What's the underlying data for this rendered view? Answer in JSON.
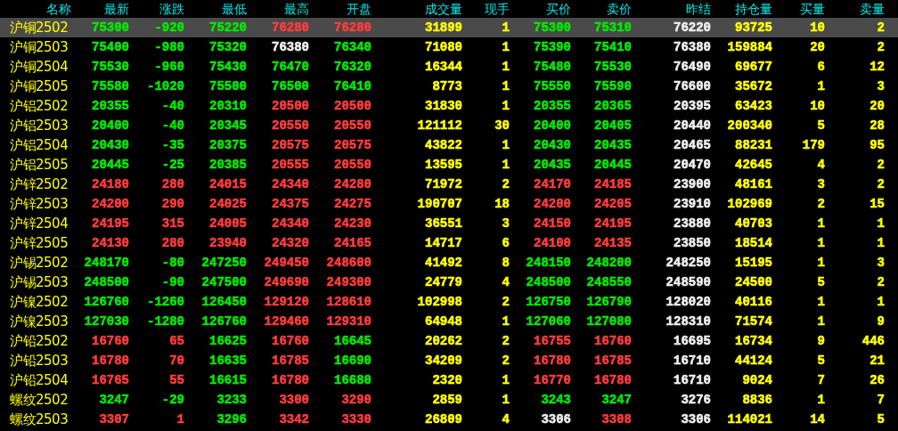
{
  "columns": [
    "名称",
    "最新",
    "涨跌",
    "最低",
    "最高",
    "开盘",
    "成交量",
    "现手",
    "买价",
    "卖价",
    "昨结",
    "持仓量",
    "买量",
    "卖量"
  ],
  "rows": [
    {
      "name": "沪铜2502",
      "selected": true,
      "cells": [
        {
          "text": "75300",
          "color": "#00ea00"
        },
        {
          "text": "-920",
          "color": "#00ea00"
        },
        {
          "text": "75220",
          "color": "#00ea00"
        },
        {
          "text": "76280",
          "color": "#ff3c3c"
        },
        {
          "text": "76280",
          "color": "#ff3c3c"
        },
        {
          "text": "31899",
          "color": "#ffff00"
        },
        {
          "text": "1",
          "color": "#ffff00"
        },
        {
          "text": "75300",
          "color": "#00ea00"
        },
        {
          "text": "75310",
          "color": "#00ea00"
        },
        {
          "text": "76220",
          "color": "#eeeeee"
        },
        {
          "text": "93725",
          "color": "#ffff00"
        },
        {
          "text": "10",
          "color": "#ffff00"
        },
        {
          "text": "2",
          "color": "#ffff00"
        }
      ]
    },
    {
      "name": "沪铜2503",
      "selected": false,
      "cells": [
        {
          "text": "75400",
          "color": "#00ea00"
        },
        {
          "text": "-980",
          "color": "#00ea00"
        },
        {
          "text": "75320",
          "color": "#00ea00"
        },
        {
          "text": "76380",
          "color": "#eeeeee"
        },
        {
          "text": "76340",
          "color": "#00ea00"
        },
        {
          "text": "71080",
          "color": "#ffff00"
        },
        {
          "text": "1",
          "color": "#ffff00"
        },
        {
          "text": "75390",
          "color": "#00ea00"
        },
        {
          "text": "75410",
          "color": "#00ea00"
        },
        {
          "text": "76380",
          "color": "#eeeeee"
        },
        {
          "text": "159884",
          "color": "#ffff00"
        },
        {
          "text": "20",
          "color": "#ffff00"
        },
        {
          "text": "2",
          "color": "#ffff00"
        }
      ]
    },
    {
      "name": "沪铜2504",
      "selected": false,
      "cells": [
        {
          "text": "75530",
          "color": "#00ea00"
        },
        {
          "text": "-960",
          "color": "#00ea00"
        },
        {
          "text": "75430",
          "color": "#00ea00"
        },
        {
          "text": "76470",
          "color": "#00ea00"
        },
        {
          "text": "76320",
          "color": "#00ea00"
        },
        {
          "text": "16344",
          "color": "#ffff00"
        },
        {
          "text": "1",
          "color": "#ffff00"
        },
        {
          "text": "75480",
          "color": "#00ea00"
        },
        {
          "text": "75530",
          "color": "#00ea00"
        },
        {
          "text": "76490",
          "color": "#eeeeee"
        },
        {
          "text": "69677",
          "color": "#ffff00"
        },
        {
          "text": "6",
          "color": "#ffff00"
        },
        {
          "text": "12",
          "color": "#ffff00"
        }
      ]
    },
    {
      "name": "沪铜2505",
      "selected": false,
      "cells": [
        {
          "text": "75580",
          "color": "#00ea00"
        },
        {
          "text": "-1020",
          "color": "#00ea00"
        },
        {
          "text": "75500",
          "color": "#00ea00"
        },
        {
          "text": "76500",
          "color": "#00ea00"
        },
        {
          "text": "76410",
          "color": "#00ea00"
        },
        {
          "text": "8773",
          "color": "#ffff00"
        },
        {
          "text": "1",
          "color": "#ffff00"
        },
        {
          "text": "75550",
          "color": "#00ea00"
        },
        {
          "text": "75590",
          "color": "#00ea00"
        },
        {
          "text": "76600",
          "color": "#eeeeee"
        },
        {
          "text": "35672",
          "color": "#ffff00"
        },
        {
          "text": "1",
          "color": "#ffff00"
        },
        {
          "text": "3",
          "color": "#ffff00"
        }
      ]
    },
    {
      "name": "沪铝2502",
      "selected": false,
      "cells": [
        {
          "text": "20355",
          "color": "#00ea00"
        },
        {
          "text": "-40",
          "color": "#00ea00"
        },
        {
          "text": "20310",
          "color": "#00ea00"
        },
        {
          "text": "20500",
          "color": "#ff3c3c"
        },
        {
          "text": "20500",
          "color": "#ff3c3c"
        },
        {
          "text": "31830",
          "color": "#ffff00"
        },
        {
          "text": "1",
          "color": "#ffff00"
        },
        {
          "text": "20355",
          "color": "#00ea00"
        },
        {
          "text": "20365",
          "color": "#00ea00"
        },
        {
          "text": "20395",
          "color": "#eeeeee"
        },
        {
          "text": "63423",
          "color": "#ffff00"
        },
        {
          "text": "10",
          "color": "#ffff00"
        },
        {
          "text": "20",
          "color": "#ffff00"
        }
      ]
    },
    {
      "name": "沪铝2503",
      "selected": false,
      "cells": [
        {
          "text": "20400",
          "color": "#00ea00"
        },
        {
          "text": "-40",
          "color": "#00ea00"
        },
        {
          "text": "20345",
          "color": "#00ea00"
        },
        {
          "text": "20550",
          "color": "#ff3c3c"
        },
        {
          "text": "20550",
          "color": "#ff3c3c"
        },
        {
          "text": "121112",
          "color": "#ffff00"
        },
        {
          "text": "30",
          "color": "#ffff00"
        },
        {
          "text": "20400",
          "color": "#00ea00"
        },
        {
          "text": "20405",
          "color": "#00ea00"
        },
        {
          "text": "20440",
          "color": "#eeeeee"
        },
        {
          "text": "200340",
          "color": "#ffff00"
        },
        {
          "text": "5",
          "color": "#ffff00"
        },
        {
          "text": "28",
          "color": "#ffff00"
        }
      ]
    },
    {
      "name": "沪铝2504",
      "selected": false,
      "cells": [
        {
          "text": "20430",
          "color": "#00ea00"
        },
        {
          "text": "-35",
          "color": "#00ea00"
        },
        {
          "text": "20375",
          "color": "#00ea00"
        },
        {
          "text": "20575",
          "color": "#ff3c3c"
        },
        {
          "text": "20575",
          "color": "#ff3c3c"
        },
        {
          "text": "43822",
          "color": "#ffff00"
        },
        {
          "text": "1",
          "color": "#ffff00"
        },
        {
          "text": "20430",
          "color": "#00ea00"
        },
        {
          "text": "20435",
          "color": "#00ea00"
        },
        {
          "text": "20465",
          "color": "#eeeeee"
        },
        {
          "text": "88231",
          "color": "#ffff00"
        },
        {
          "text": "179",
          "color": "#ffff00"
        },
        {
          "text": "95",
          "color": "#ffff00"
        }
      ]
    },
    {
      "name": "沪铝2505",
      "selected": false,
      "cells": [
        {
          "text": "20445",
          "color": "#00ea00"
        },
        {
          "text": "-25",
          "color": "#00ea00"
        },
        {
          "text": "20385",
          "color": "#00ea00"
        },
        {
          "text": "20555",
          "color": "#ff3c3c"
        },
        {
          "text": "20550",
          "color": "#ff3c3c"
        },
        {
          "text": "13595",
          "color": "#ffff00"
        },
        {
          "text": "1",
          "color": "#ffff00"
        },
        {
          "text": "20435",
          "color": "#00ea00"
        },
        {
          "text": "20445",
          "color": "#00ea00"
        },
        {
          "text": "20470",
          "color": "#eeeeee"
        },
        {
          "text": "42645",
          "color": "#ffff00"
        },
        {
          "text": "4",
          "color": "#ffff00"
        },
        {
          "text": "2",
          "color": "#ffff00"
        }
      ]
    },
    {
      "name": "沪锌2502",
      "selected": false,
      "cells": [
        {
          "text": "24180",
          "color": "#ff3c3c"
        },
        {
          "text": "280",
          "color": "#ff3c3c"
        },
        {
          "text": "24015",
          "color": "#ff3c3c"
        },
        {
          "text": "24340",
          "color": "#ff3c3c"
        },
        {
          "text": "24280",
          "color": "#ff3c3c"
        },
        {
          "text": "71972",
          "color": "#ffff00"
        },
        {
          "text": "2",
          "color": "#ffff00"
        },
        {
          "text": "24170",
          "color": "#ff3c3c"
        },
        {
          "text": "24185",
          "color": "#ff3c3c"
        },
        {
          "text": "23900",
          "color": "#eeeeee"
        },
        {
          "text": "48161",
          "color": "#ffff00"
        },
        {
          "text": "3",
          "color": "#ffff00"
        },
        {
          "text": "2",
          "color": "#ffff00"
        }
      ]
    },
    {
      "name": "沪锌2503",
      "selected": false,
      "cells": [
        {
          "text": "24200",
          "color": "#ff3c3c"
        },
        {
          "text": "290",
          "color": "#ff3c3c"
        },
        {
          "text": "24025",
          "color": "#ff3c3c"
        },
        {
          "text": "24375",
          "color": "#ff3c3c"
        },
        {
          "text": "24275",
          "color": "#ff3c3c"
        },
        {
          "text": "190707",
          "color": "#ffff00"
        },
        {
          "text": "18",
          "color": "#ffff00"
        },
        {
          "text": "24200",
          "color": "#ff3c3c"
        },
        {
          "text": "24205",
          "color": "#ff3c3c"
        },
        {
          "text": "23910",
          "color": "#eeeeee"
        },
        {
          "text": "102969",
          "color": "#ffff00"
        },
        {
          "text": "2",
          "color": "#ffff00"
        },
        {
          "text": "15",
          "color": "#ffff00"
        }
      ]
    },
    {
      "name": "沪锌2504",
      "selected": false,
      "cells": [
        {
          "text": "24195",
          "color": "#ff3c3c"
        },
        {
          "text": "315",
          "color": "#ff3c3c"
        },
        {
          "text": "24005",
          "color": "#ff3c3c"
        },
        {
          "text": "24340",
          "color": "#ff3c3c"
        },
        {
          "text": "24230",
          "color": "#ff3c3c"
        },
        {
          "text": "36551",
          "color": "#ffff00"
        },
        {
          "text": "3",
          "color": "#ffff00"
        },
        {
          "text": "24150",
          "color": "#ff3c3c"
        },
        {
          "text": "24195",
          "color": "#ff3c3c"
        },
        {
          "text": "23880",
          "color": "#eeeeee"
        },
        {
          "text": "40703",
          "color": "#ffff00"
        },
        {
          "text": "1",
          "color": "#ffff00"
        },
        {
          "text": "1",
          "color": "#ffff00"
        }
      ]
    },
    {
      "name": "沪锌2505",
      "selected": false,
      "cells": [
        {
          "text": "24130",
          "color": "#ff3c3c"
        },
        {
          "text": "280",
          "color": "#ff3c3c"
        },
        {
          "text": "23940",
          "color": "#ff3c3c"
        },
        {
          "text": "24320",
          "color": "#ff3c3c"
        },
        {
          "text": "24165",
          "color": "#ff3c3c"
        },
        {
          "text": "14717",
          "color": "#ffff00"
        },
        {
          "text": "6",
          "color": "#ffff00"
        },
        {
          "text": "24100",
          "color": "#ff3c3c"
        },
        {
          "text": "24135",
          "color": "#ff3c3c"
        },
        {
          "text": "23850",
          "color": "#eeeeee"
        },
        {
          "text": "18514",
          "color": "#ffff00"
        },
        {
          "text": "1",
          "color": "#ffff00"
        },
        {
          "text": "1",
          "color": "#ffff00"
        }
      ]
    },
    {
      "name": "沪锡2502",
      "selected": false,
      "cells": [
        {
          "text": "248170",
          "color": "#00ea00"
        },
        {
          "text": "-80",
          "color": "#00ea00"
        },
        {
          "text": "247250",
          "color": "#00ea00"
        },
        {
          "text": "249450",
          "color": "#ff3c3c"
        },
        {
          "text": "248600",
          "color": "#ff3c3c"
        },
        {
          "text": "41492",
          "color": "#ffff00"
        },
        {
          "text": "8",
          "color": "#ffff00"
        },
        {
          "text": "248150",
          "color": "#00ea00"
        },
        {
          "text": "248200",
          "color": "#00ea00"
        },
        {
          "text": "248250",
          "color": "#eeeeee"
        },
        {
          "text": "15195",
          "color": "#ffff00"
        },
        {
          "text": "1",
          "color": "#ffff00"
        },
        {
          "text": "3",
          "color": "#ffff00"
        }
      ]
    },
    {
      "name": "沪锡2503",
      "selected": false,
      "cells": [
        {
          "text": "248500",
          "color": "#00ea00"
        },
        {
          "text": "-90",
          "color": "#00ea00"
        },
        {
          "text": "247500",
          "color": "#00ea00"
        },
        {
          "text": "249690",
          "color": "#ff3c3c"
        },
        {
          "text": "249300",
          "color": "#ff3c3c"
        },
        {
          "text": "24779",
          "color": "#ffff00"
        },
        {
          "text": "4",
          "color": "#ffff00"
        },
        {
          "text": "248500",
          "color": "#00ea00"
        },
        {
          "text": "248550",
          "color": "#00ea00"
        },
        {
          "text": "248590",
          "color": "#eeeeee"
        },
        {
          "text": "24500",
          "color": "#ffff00"
        },
        {
          "text": "5",
          "color": "#ffff00"
        },
        {
          "text": "2",
          "color": "#ffff00"
        }
      ]
    },
    {
      "name": "沪镍2502",
      "selected": false,
      "cells": [
        {
          "text": "126760",
          "color": "#00ea00"
        },
        {
          "text": "-1260",
          "color": "#00ea00"
        },
        {
          "text": "126450",
          "color": "#00ea00"
        },
        {
          "text": "129120",
          "color": "#ff3c3c"
        },
        {
          "text": "128610",
          "color": "#ff3c3c"
        },
        {
          "text": "102998",
          "color": "#ffff00"
        },
        {
          "text": "2",
          "color": "#ffff00"
        },
        {
          "text": "126750",
          "color": "#00ea00"
        },
        {
          "text": "126790",
          "color": "#00ea00"
        },
        {
          "text": "128020",
          "color": "#eeeeee"
        },
        {
          "text": "40116",
          "color": "#ffff00"
        },
        {
          "text": "1",
          "color": "#ffff00"
        },
        {
          "text": "1",
          "color": "#ffff00"
        }
      ]
    },
    {
      "name": "沪镍2503",
      "selected": false,
      "cells": [
        {
          "text": "127030",
          "color": "#00ea00"
        },
        {
          "text": "-1280",
          "color": "#00ea00"
        },
        {
          "text": "126760",
          "color": "#00ea00"
        },
        {
          "text": "129460",
          "color": "#ff3c3c"
        },
        {
          "text": "129310",
          "color": "#ff3c3c"
        },
        {
          "text": "64948",
          "color": "#ffff00"
        },
        {
          "text": "1",
          "color": "#ffff00"
        },
        {
          "text": "127060",
          "color": "#00ea00"
        },
        {
          "text": "127080",
          "color": "#00ea00"
        },
        {
          "text": "128310",
          "color": "#eeeeee"
        },
        {
          "text": "71574",
          "color": "#ffff00"
        },
        {
          "text": "1",
          "color": "#ffff00"
        },
        {
          "text": "9",
          "color": "#ffff00"
        }
      ]
    },
    {
      "name": "沪铅2502",
      "selected": false,
      "cells": [
        {
          "text": "16760",
          "color": "#ff3c3c"
        },
        {
          "text": "65",
          "color": "#ff3c3c"
        },
        {
          "text": "16625",
          "color": "#00ea00"
        },
        {
          "text": "16760",
          "color": "#ff3c3c"
        },
        {
          "text": "16645",
          "color": "#00ea00"
        },
        {
          "text": "20262",
          "color": "#ffff00"
        },
        {
          "text": "2",
          "color": "#ffff00"
        },
        {
          "text": "16755",
          "color": "#ff3c3c"
        },
        {
          "text": "16760",
          "color": "#ff3c3c"
        },
        {
          "text": "16695",
          "color": "#eeeeee"
        },
        {
          "text": "16734",
          "color": "#ffff00"
        },
        {
          "text": "9",
          "color": "#ffff00"
        },
        {
          "text": "446",
          "color": "#ffff00"
        }
      ]
    },
    {
      "name": "沪铅2503",
      "selected": false,
      "cells": [
        {
          "text": "16780",
          "color": "#ff3c3c"
        },
        {
          "text": "70",
          "color": "#ff3c3c"
        },
        {
          "text": "16635",
          "color": "#00ea00"
        },
        {
          "text": "16785",
          "color": "#ff3c3c"
        },
        {
          "text": "16690",
          "color": "#00ea00"
        },
        {
          "text": "34209",
          "color": "#ffff00"
        },
        {
          "text": "2",
          "color": "#ffff00"
        },
        {
          "text": "16780",
          "color": "#ff3c3c"
        },
        {
          "text": "16785",
          "color": "#ff3c3c"
        },
        {
          "text": "16710",
          "color": "#eeeeee"
        },
        {
          "text": "44124",
          "color": "#ffff00"
        },
        {
          "text": "5",
          "color": "#ffff00"
        },
        {
          "text": "21",
          "color": "#ffff00"
        }
      ]
    },
    {
      "name": "沪铅2504",
      "selected": false,
      "cells": [
        {
          "text": "16765",
          "color": "#ff3c3c"
        },
        {
          "text": "55",
          "color": "#ff3c3c"
        },
        {
          "text": "16615",
          "color": "#00ea00"
        },
        {
          "text": "16780",
          "color": "#ff3c3c"
        },
        {
          "text": "16680",
          "color": "#00ea00"
        },
        {
          "text": "2320",
          "color": "#ffff00"
        },
        {
          "text": "1",
          "color": "#ffff00"
        },
        {
          "text": "16770",
          "color": "#ff3c3c"
        },
        {
          "text": "16780",
          "color": "#ff3c3c"
        },
        {
          "text": "16710",
          "color": "#eeeeee"
        },
        {
          "text": "9024",
          "color": "#ffff00"
        },
        {
          "text": "7",
          "color": "#ffff00"
        },
        {
          "text": "26",
          "color": "#ffff00"
        }
      ]
    },
    {
      "name": "螺纹2502",
      "selected": false,
      "cells": [
        {
          "text": "3247",
          "color": "#00ea00"
        },
        {
          "text": "-29",
          "color": "#00ea00"
        },
        {
          "text": "3233",
          "color": "#00ea00"
        },
        {
          "text": "3300",
          "color": "#ff3c3c"
        },
        {
          "text": "3290",
          "color": "#ff3c3c"
        },
        {
          "text": "2859",
          "color": "#ffff00"
        },
        {
          "text": "1",
          "color": "#ffff00"
        },
        {
          "text": "3243",
          "color": "#00ea00"
        },
        {
          "text": "3247",
          "color": "#00ea00"
        },
        {
          "text": "3276",
          "color": "#eeeeee"
        },
        {
          "text": "8836",
          "color": "#ffff00"
        },
        {
          "text": "1",
          "color": "#ffff00"
        },
        {
          "text": "7",
          "color": "#ffff00"
        }
      ]
    },
    {
      "name": "螺纹2503",
      "selected": false,
      "cells": [
        {
          "text": "3307",
          "color": "#ff3c3c"
        },
        {
          "text": "1",
          "color": "#ff3c3c"
        },
        {
          "text": "3296",
          "color": "#00ea00"
        },
        {
          "text": "3342",
          "color": "#ff3c3c"
        },
        {
          "text": "3330",
          "color": "#ff3c3c"
        },
        {
          "text": "26809",
          "color": "#ffff00"
        },
        {
          "text": "4",
          "color": "#ffff00"
        },
        {
          "text": "3306",
          "color": "#eeeeee"
        },
        {
          "text": "3308",
          "color": "#ff3c3c"
        },
        {
          "text": "3306",
          "color": "#eeeeee"
        },
        {
          "text": "114021",
          "color": "#ffff00"
        },
        {
          "text": "14",
          "color": "#ffff00"
        },
        {
          "text": "5",
          "color": "#ffff00"
        }
      ]
    }
  ]
}
